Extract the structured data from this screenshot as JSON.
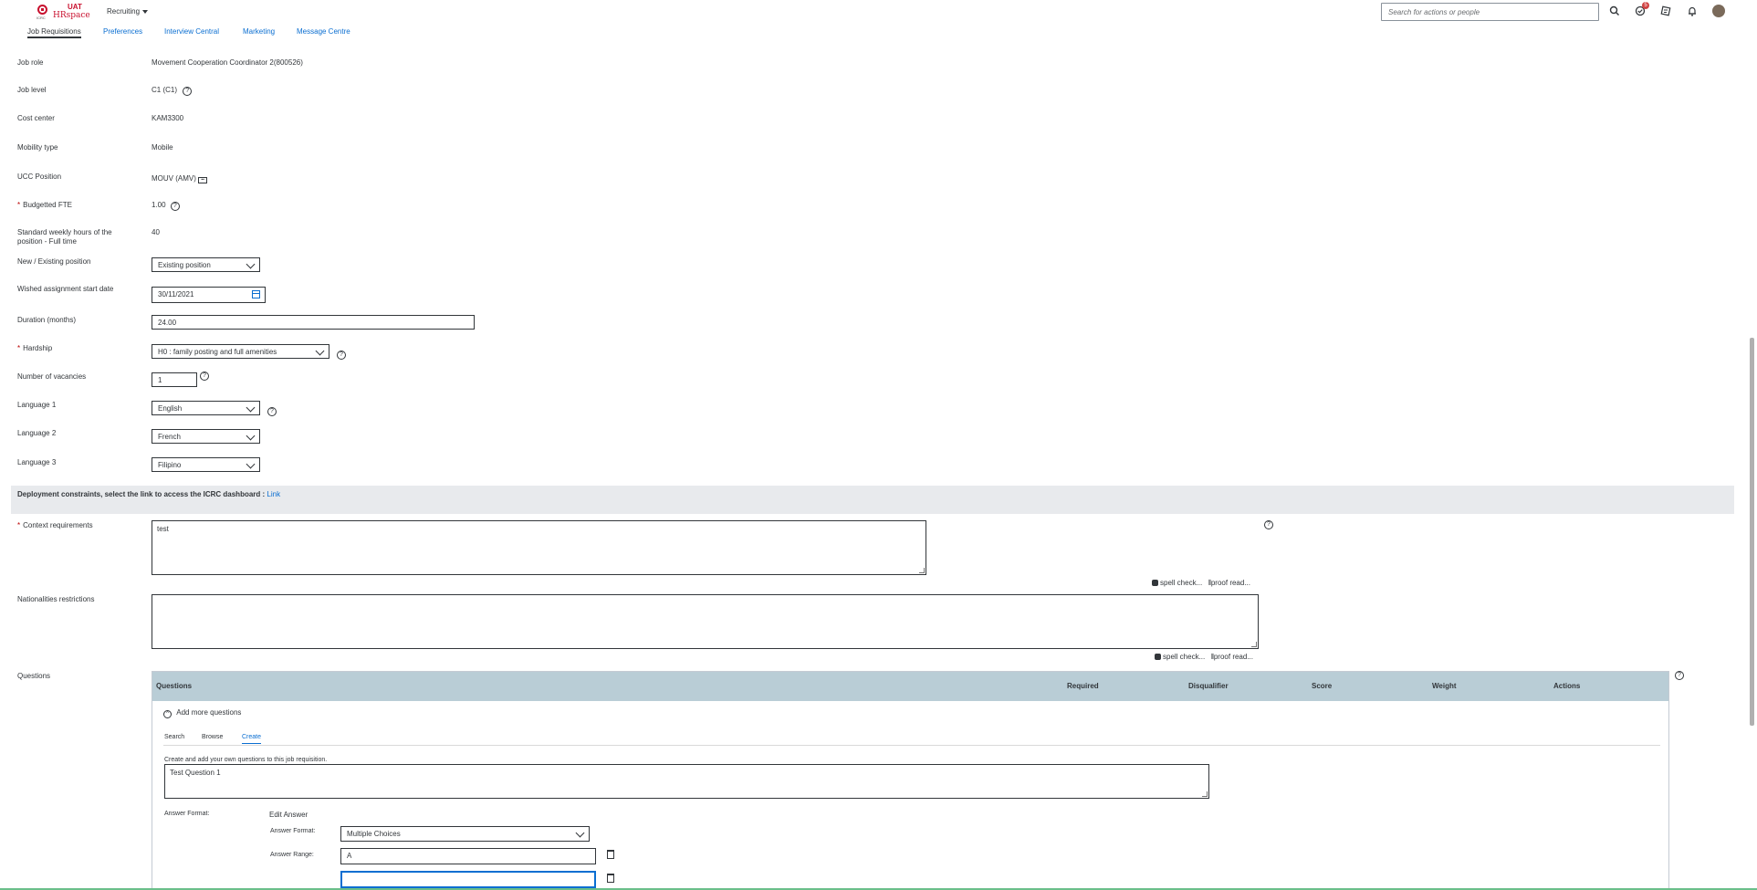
{
  "header": {
    "logo_uat": "UAT",
    "logo_brand": "HRspace",
    "logo_org": "ICRC",
    "module": "Recruiting",
    "search_placeholder": "Search for actions or people",
    "notification_badge": "5",
    "icons": [
      "search-icon",
      "approvals-icon",
      "todo-icon",
      "bell-icon",
      "avatar"
    ]
  },
  "nav": {
    "tabs": [
      "Job Requisitions",
      "Preferences",
      "Interview Central",
      "Marketing",
      "Message Centre"
    ],
    "active": "Job Requisitions"
  },
  "form": {
    "job_role": {
      "label": "Job role",
      "value": "Movement Cooperation Coordinator 2(800526)"
    },
    "job_level": {
      "label": "Job level",
      "value": "C1 (C1)"
    },
    "cost_center": {
      "label": "Cost center",
      "value": "KAM3300"
    },
    "mobility_type": {
      "label": "Mobility type",
      "value": "Mobile"
    },
    "ucc_position": {
      "label": "UCC Position",
      "value": "MOUV (AMV)"
    },
    "budgetted_fte": {
      "label": "Budgetted FTE",
      "value": "1.00",
      "required": "*"
    },
    "weekly_hours": {
      "label": "Standard weekly hours of the position - Full time",
      "value": "40"
    },
    "new_existing": {
      "label": "New / Existing position",
      "value": "Existing position"
    },
    "start_date": {
      "label": "Wished assignment start date",
      "value": "30/11/2021"
    },
    "duration": {
      "label": "Duration (months)",
      "value": "24.00"
    },
    "hardship": {
      "label": "Hardship",
      "value": "H0 : family posting and full amenities",
      "required": "*"
    },
    "vacancies": {
      "label": "Number of vacancies",
      "value": "1"
    },
    "language1": {
      "label": "Language 1",
      "value": "English"
    },
    "language2": {
      "label": "Language 2",
      "value": "French"
    },
    "language3": {
      "label": "Language 3",
      "value": "Filipino"
    }
  },
  "section": {
    "title": "Deployment constraints, select the link to access the ICRC dashboard :",
    "link": "Link"
  },
  "context": {
    "label": "Context requirements",
    "required": "*",
    "value": "test"
  },
  "nationalities": {
    "label": "Nationalities restrictions",
    "value": ""
  },
  "tools": {
    "spell": "spell check...",
    "proof": "proof read..."
  },
  "questions": {
    "label": "Questions",
    "columns": [
      "Questions",
      "Required",
      "Disqualifier",
      "Score",
      "Weight",
      "Actions"
    ],
    "add_more": "Add more questions",
    "tabs": [
      "Search",
      "Browse",
      "Create"
    ],
    "active_tab": "Create",
    "hint": "Create and add your own questions to this job requisition.",
    "question_text": "Test Question 1",
    "answer_format_label": "Answer Format:",
    "edit_answer": "Edit Answer",
    "answer_format_label2": "Answer Format:",
    "answer_format_value": "Multiple Choices",
    "answer_range_label": "Answer Range:",
    "answer_range_value": "A",
    "answer_range_value2": ""
  }
}
